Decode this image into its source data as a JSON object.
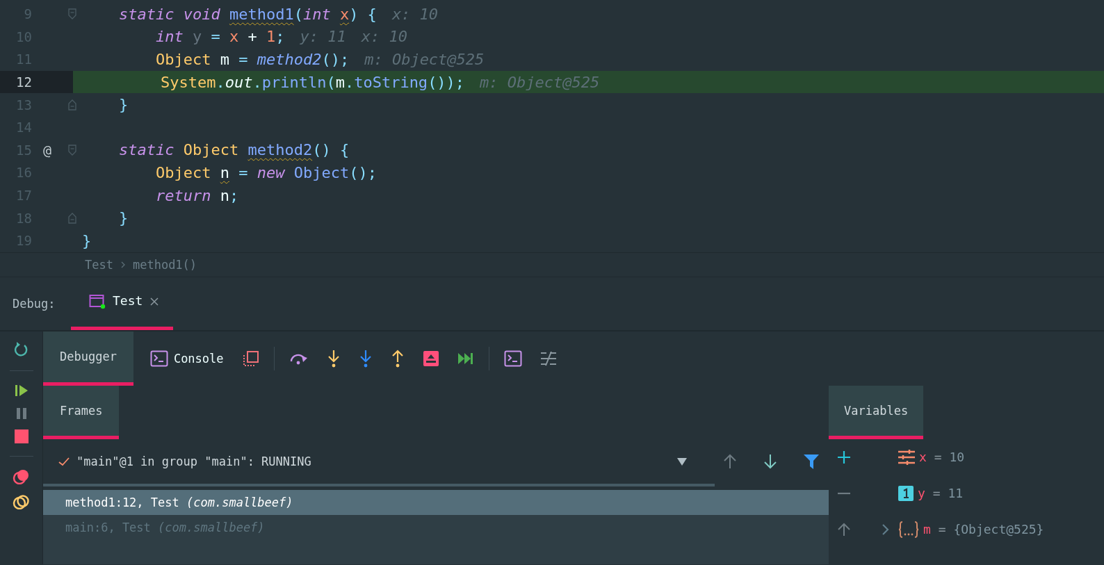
{
  "editor": {
    "lines": [
      {
        "number": "9",
        "kind": "fold_start",
        "tokens": [
          {
            "t": "    static void ",
            "kind": "keyword"
          },
          {
            "t": "method1",
            "kind": "method",
            "warn": true
          },
          {
            "t": "(",
            "kind": "punct"
          },
          {
            "t": "int ",
            "kind": "keyword"
          },
          {
            "t": "x",
            "kind": "param",
            "warn": true
          },
          {
            "t": ") {",
            "kind": "punct"
          }
        ],
        "hints": [
          "x: 10"
        ],
        "current": false
      },
      {
        "number": "10",
        "kind": "plain",
        "tokens": [
          {
            "t": "        int ",
            "kind": "keyword"
          },
          {
            "t": "y ",
            "kind": "unused"
          },
          {
            "t": "= ",
            "kind": "punct"
          },
          {
            "t": "x",
            "kind": "param"
          },
          {
            "t": " + ",
            "kind": "plain"
          },
          {
            "t": "1",
            "kind": "param"
          },
          {
            "t": ";",
            "kind": "punct"
          }
        ],
        "hints": [
          "y: 11",
          "x: 10"
        ],
        "current": false
      },
      {
        "number": "11",
        "kind": "plain",
        "tokens": [
          {
            "t": "        Object",
            "kind": "type"
          },
          {
            "t": " m ",
            "kind": "plain"
          },
          {
            "t": "= ",
            "kind": "punct"
          },
          {
            "t": "method2",
            "kind": "method_italic"
          },
          {
            "t": "();",
            "kind": "punct"
          }
        ],
        "hints": [
          "m: Object@525"
        ],
        "current": false
      },
      {
        "number": "12",
        "kind": "plain",
        "tokens": [
          {
            "t": "        System",
            "kind": "type"
          },
          {
            "t": ".",
            "kind": "punct"
          },
          {
            "t": "out",
            "kind": "field"
          },
          {
            "t": ".",
            "kind": "punct"
          },
          {
            "t": "println",
            "kind": "method"
          },
          {
            "t": "(",
            "kind": "punct"
          },
          {
            "t": "m",
            "kind": "plain"
          },
          {
            "t": ".",
            "kind": "punct"
          },
          {
            "t": "toString",
            "kind": "method"
          },
          {
            "t": "());",
            "kind": "punct"
          }
        ],
        "hints": [
          "m: Object@525"
        ],
        "current": true
      },
      {
        "number": "13",
        "kind": "fold_end",
        "tokens": [
          {
            "t": "    }",
            "kind": "punct"
          }
        ],
        "current": false
      },
      {
        "number": "14",
        "kind": "plain",
        "current": false
      },
      {
        "number": "15",
        "kind": "fold_start",
        "gutter_mark": "@",
        "tokens": [
          {
            "t": "    static ",
            "kind": "keyword"
          },
          {
            "t": "Object ",
            "kind": "type"
          },
          {
            "t": "method2",
            "kind": "method",
            "warn": true
          },
          {
            "t": "() {",
            "kind": "punct"
          }
        ],
        "current": false
      },
      {
        "number": "16",
        "kind": "plain",
        "tokens": [
          {
            "t": "        Object ",
            "kind": "type"
          },
          {
            "t": "n",
            "kind": "plain",
            "warn": true
          },
          {
            "t": " = ",
            "kind": "punct"
          },
          {
            "t": "new ",
            "kind": "keyword"
          },
          {
            "t": "Object",
            "kind": "method"
          },
          {
            "t": "();",
            "kind": "punct"
          }
        ],
        "current": false
      },
      {
        "number": "17",
        "kind": "plain",
        "tokens": [
          {
            "t": "        return",
            "kind": "keyword"
          },
          {
            "t": " n",
            "kind": "plain"
          },
          {
            "t": ";",
            "kind": "punct"
          }
        ],
        "current": false
      },
      {
        "number": "18",
        "kind": "fold_end",
        "tokens": [
          {
            "t": "    }",
            "kind": "punct"
          }
        ],
        "current": false
      },
      {
        "number": "19",
        "kind": "plain",
        "tokens": [
          {
            "t": "}",
            "kind": "punct"
          }
        ],
        "current": false
      }
    ],
    "breadcrumbs": [
      "Test",
      "method1()"
    ]
  },
  "debug": {
    "label": "Debug:",
    "tabs": [
      {
        "label": "Test",
        "selected": true
      }
    ],
    "side_tools": [
      {
        "kind": "rerun"
      },
      {
        "kind": "sep"
      },
      {
        "kind": "resume"
      },
      {
        "kind": "pause"
      },
      {
        "kind": "stop"
      },
      {
        "kind": "sep"
      },
      {
        "kind": "breakpoints"
      },
      {
        "kind": "mute"
      }
    ],
    "view_tabs": [
      {
        "label": "Debugger",
        "selected": true
      }
    ],
    "console": "Console",
    "tools": [
      {
        "kind": "layout"
      },
      {
        "kind": "sep"
      },
      {
        "kind": "step_over"
      },
      {
        "kind": "step_into"
      },
      {
        "kind": "force_step_into"
      },
      {
        "kind": "step_out"
      },
      {
        "kind": "drop_frame"
      },
      {
        "kind": "run_to_cursor"
      },
      {
        "kind": "sep"
      },
      {
        "kind": "evaluate"
      },
      {
        "kind": "trace"
      }
    ],
    "frames": {
      "tabs": [
        {
          "label": "Frames",
          "selected": true
        }
      ],
      "thread": "\"main\"@1 in group \"main\": RUNNING",
      "items": [
        {
          "text": "method1:12, Test *(com.smallbeef)*",
          "selected": true
        },
        {
          "text": "main:6, Test *(com.smallbeef)*",
          "selected": false
        }
      ]
    },
    "variables": {
      "tabs": [
        {
          "label": "Variables",
          "selected": true
        }
      ],
      "tools": [
        {
          "kind": "add"
        },
        {
          "kind": "remove"
        },
        {
          "kind": "up"
        }
      ],
      "items": [
        {
          "kind": "param",
          "name": "x",
          "op": "=",
          "value": "10",
          "expandable": false
        },
        {
          "kind": "primitive",
          "name": "y",
          "op": "=",
          "value": "11",
          "expandable": false
        },
        {
          "kind": "object",
          "name": "m",
          "op": "=",
          "value": "{Object@525}",
          "expandable": true
        }
      ]
    }
  }
}
